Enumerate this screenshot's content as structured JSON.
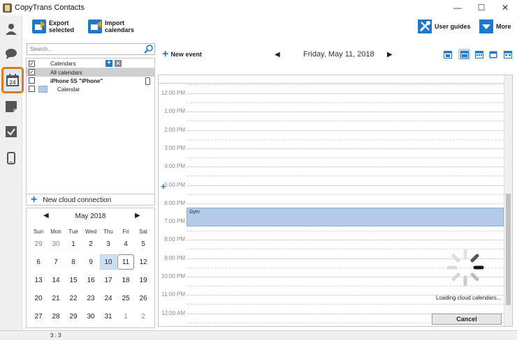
{
  "window": {
    "title": "CopyTrans Contacts",
    "min_glyph": "—",
    "max_glyph": "☐",
    "close_glyph": "✕"
  },
  "toolbar": {
    "export_line1": "Export",
    "export_line2": "selected",
    "import_line1": "Import",
    "import_line2": "calendars",
    "user_guides": "User guides",
    "more": "More"
  },
  "search": {
    "placeholder": "Search..."
  },
  "calendars": {
    "header": "Calendars",
    "all": "All calendars",
    "device": "iPhone 5S \"iPhone\"",
    "calendar": "Calendar",
    "new_cloud": "New cloud connection"
  },
  "minical": {
    "month": "May 2018",
    "dow": [
      "Sun",
      "Mon",
      "Tue",
      "Wed",
      "Thu",
      "Fri",
      "Sat"
    ],
    "weeks": [
      [
        "29",
        "30",
        "1",
        "2",
        "3",
        "4",
        "5"
      ],
      [
        "6",
        "7",
        "8",
        "9",
        "10",
        "11",
        "12"
      ],
      [
        "13",
        "14",
        "15",
        "16",
        "17",
        "18",
        "19"
      ],
      [
        "20",
        "21",
        "22",
        "23",
        "24",
        "25",
        "26"
      ],
      [
        "27",
        "28",
        "29",
        "30",
        "31",
        "1",
        "2"
      ]
    ]
  },
  "main": {
    "new_event": "New event",
    "date": "Friday, May 11, 2018",
    "hours": [
      "12:00 PM",
      "1:00 PM",
      "2:00 PM",
      "3:00 PM",
      "4:00 PM",
      "5:00 PM",
      "6:00 PM",
      "7:00 PM",
      "8:00 PM",
      "9:00 PM",
      "10:00 PM",
      "11:00 PM",
      "12:00 AM"
    ],
    "event_title": "Gym",
    "loading": "Loading cloud calendars...",
    "cancel": "Cancel"
  },
  "status": {
    "text": "3 : 3"
  },
  "colors": {
    "accent": "#1f78c8",
    "highlight": "#e07a16",
    "event": "#b3cbe8"
  }
}
